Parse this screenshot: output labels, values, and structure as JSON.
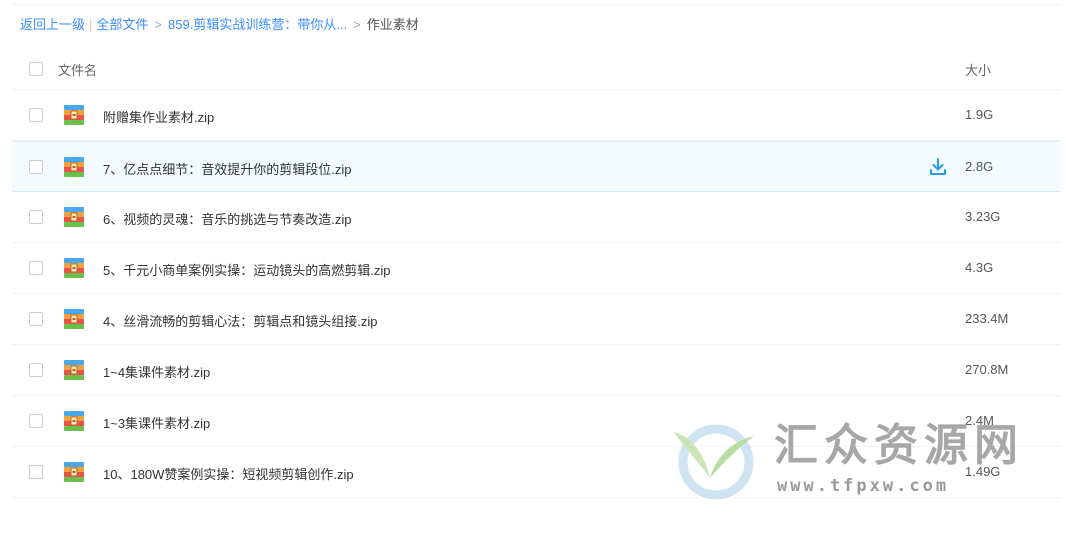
{
  "breadcrumb": {
    "back": "返回上一级",
    "divider": "|",
    "all_files": "全部文件",
    "separator": ">",
    "folder": "859.剪辑实战训练营：带你从...",
    "current": "作业素材"
  },
  "table": {
    "columns": {
      "name": "文件名",
      "size": "大小"
    },
    "rows": [
      {
        "name": "附赠集作业素材.zip",
        "size": "1.9G",
        "hover": false
      },
      {
        "name": "7、亿点点细节：音效提升你的剪辑段位.zip",
        "size": "2.8G",
        "hover": true
      },
      {
        "name": "6、视频的灵魂：音乐的挑选与节奏改造.zip",
        "size": "3.23G",
        "hover": false
      },
      {
        "name": "5、千元小商单案例实操：运动镜头的高燃剪辑.zip",
        "size": "4.3G",
        "hover": false
      },
      {
        "name": "4、丝滑流畅的剪辑心法：剪辑点和镜头组接.zip",
        "size": "233.4M",
        "hover": false
      },
      {
        "name": "1~4集课件素材.zip",
        "size": "270.8M",
        "hover": false
      },
      {
        "name": "1~3集课件素材.zip",
        "size": "2.4M",
        "hover": false
      },
      {
        "name": "10、180W赞案例实操：短视频剪辑创作.zip",
        "size": "1.49G",
        "hover": false
      }
    ]
  },
  "icons": {
    "file": "zip-archive-icon",
    "download": "download-icon",
    "checkbox": "checkbox"
  },
  "colors": {
    "link": "#3b8cff",
    "hover_row": "#f4fbfe",
    "download": "#2a9be6"
  },
  "watermark": {
    "title": "汇众资源网",
    "url": "www.tfpxw.com"
  }
}
